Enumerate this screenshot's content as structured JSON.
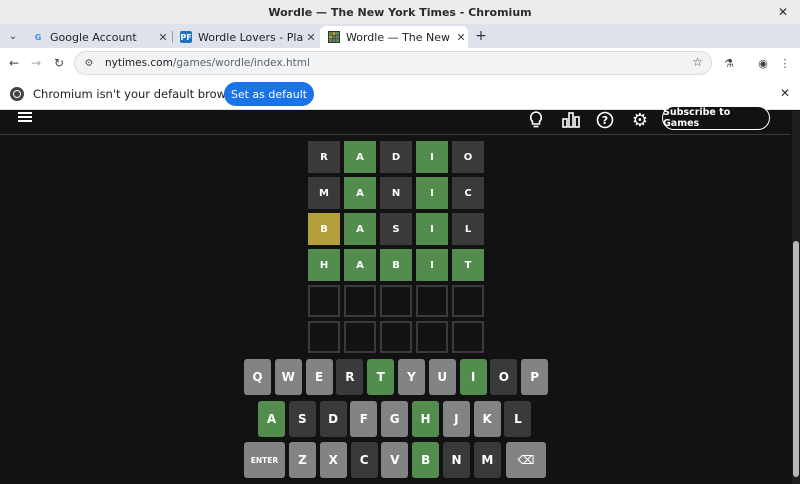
{
  "window": {
    "title": "Wordle — The New York Times - Chromium"
  },
  "tabs": [
    {
      "label": "Google Account",
      "favicon": "G",
      "favicon_color": "#4285f4"
    },
    {
      "label": "Wordle Lovers - Play t",
      "favicon": "PF",
      "favicon_color": "#1e73be"
    },
    {
      "label": "Wordle — The New Yo",
      "favicon": "grid",
      "favicon_color": "#538d4e"
    }
  ],
  "toolbar": {
    "url_host": "nytimes.com",
    "url_path": "/games/wordle/index.html"
  },
  "infobar": {
    "message": "Chromium isn't your default browser",
    "button": "Set as default"
  },
  "game": {
    "subscribe_label": "Subscribe to Games",
    "board": [
      [
        [
          "R",
          "absent"
        ],
        [
          "A",
          "correct"
        ],
        [
          "D",
          "absent"
        ],
        [
          "I",
          "correct"
        ],
        [
          "O",
          "absent"
        ]
      ],
      [
        [
          "M",
          "absent"
        ],
        [
          "A",
          "correct"
        ],
        [
          "N",
          "absent"
        ],
        [
          "I",
          "correct"
        ],
        [
          "C",
          "absent"
        ]
      ],
      [
        [
          "B",
          "present"
        ],
        [
          "A",
          "correct"
        ],
        [
          "S",
          "absent"
        ],
        [
          "I",
          "correct"
        ],
        [
          "L",
          "absent"
        ]
      ],
      [
        [
          "H",
          "correct"
        ],
        [
          "A",
          "correct"
        ],
        [
          "B",
          "correct"
        ],
        [
          "I",
          "correct"
        ],
        [
          "T",
          "correct"
        ]
      ],
      [
        [
          "",
          "empty"
        ],
        [
          "",
          "empty"
        ],
        [
          "",
          "empty"
        ],
        [
          "",
          "empty"
        ],
        [
          "",
          "empty"
        ]
      ],
      [
        [
          "",
          "empty"
        ],
        [
          "",
          "empty"
        ],
        [
          "",
          "empty"
        ],
        [
          "",
          "empty"
        ],
        [
          "",
          "empty"
        ]
      ]
    ],
    "keyboard": [
      [
        [
          "Q",
          "unused"
        ],
        [
          "W",
          "unused"
        ],
        [
          "E",
          "unused"
        ],
        [
          "R",
          "absent"
        ],
        [
          "T",
          "correct"
        ],
        [
          "Y",
          "unused"
        ],
        [
          "U",
          "unused"
        ],
        [
          "I",
          "correct"
        ],
        [
          "O",
          "absent"
        ],
        [
          "P",
          "unused"
        ]
      ],
      [
        [
          "A",
          "correct"
        ],
        [
          "S",
          "absent"
        ],
        [
          "D",
          "absent"
        ],
        [
          "F",
          "unused"
        ],
        [
          "G",
          "unused"
        ],
        [
          "H",
          "correct"
        ],
        [
          "J",
          "unused"
        ],
        [
          "K",
          "unused"
        ],
        [
          "L",
          "absent"
        ]
      ],
      [
        [
          "ENTER",
          "unused"
        ],
        [
          "Z",
          "unused"
        ],
        [
          "X",
          "unused"
        ],
        [
          "C",
          "absent"
        ],
        [
          "V",
          "unused"
        ],
        [
          "B",
          "correct"
        ],
        [
          "N",
          "absent"
        ],
        [
          "M",
          "absent"
        ],
        [
          "⌫",
          "unused"
        ]
      ]
    ]
  },
  "colors": {
    "correct": "#538d4e",
    "present": "#b59f3b",
    "absent": "#3a3a3c",
    "unused": "#818384"
  }
}
